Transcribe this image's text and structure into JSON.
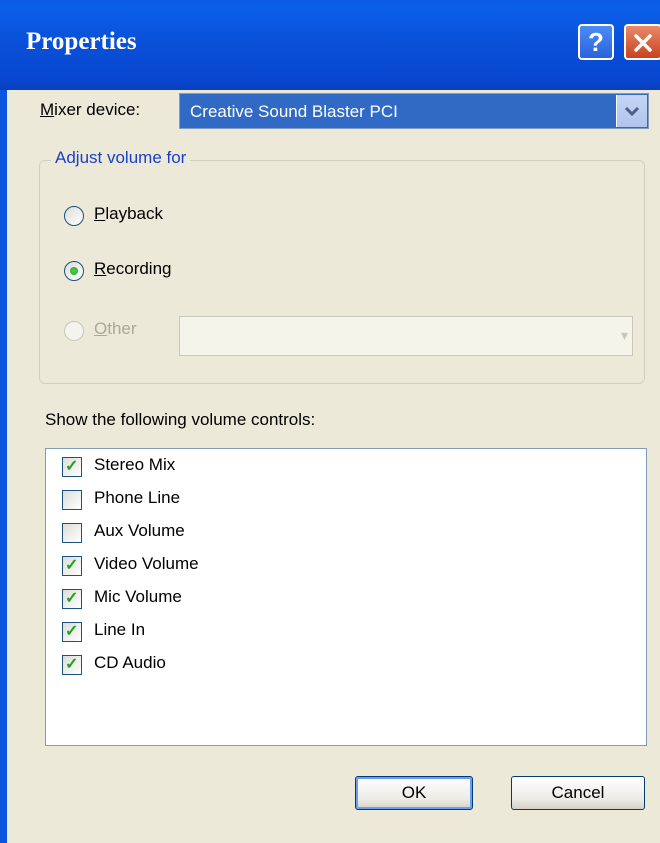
{
  "window": {
    "title": "Properties",
    "help_glyph": "?",
    "close_icon": "close-icon"
  },
  "mixer": {
    "label_mnemonic": "M",
    "label_rest": "ixer device:",
    "selected": "Creative Sound Blaster PCI"
  },
  "adjust_group": {
    "legend": "Adjust volume for",
    "options": [
      {
        "mnemonic": "P",
        "rest": "layback",
        "selected": false,
        "enabled": true
      },
      {
        "mnemonic": "R",
        "rest": "ecording",
        "selected": true,
        "enabled": true
      },
      {
        "mnemonic": "O",
        "rest": "ther",
        "selected": false,
        "enabled": false
      }
    ],
    "other_value": ""
  },
  "controls": {
    "label": "Show the following volume controls:",
    "items": [
      {
        "label": "Stereo Mix",
        "checked": true
      },
      {
        "label": "Phone Line",
        "checked": false
      },
      {
        "label": "Aux Volume",
        "checked": false
      },
      {
        "label": "Video Volume",
        "checked": true
      },
      {
        "label": "Mic Volume",
        "checked": true
      },
      {
        "label": "Line In",
        "checked": true
      },
      {
        "label": "CD Audio",
        "checked": true
      }
    ]
  },
  "buttons": {
    "ok": "OK",
    "cancel": "Cancel"
  },
  "colors": {
    "titlebar": "#0a4fd8",
    "selection": "#316ac5",
    "check": "#21a121",
    "dialog_bg": "#ece9d8"
  }
}
